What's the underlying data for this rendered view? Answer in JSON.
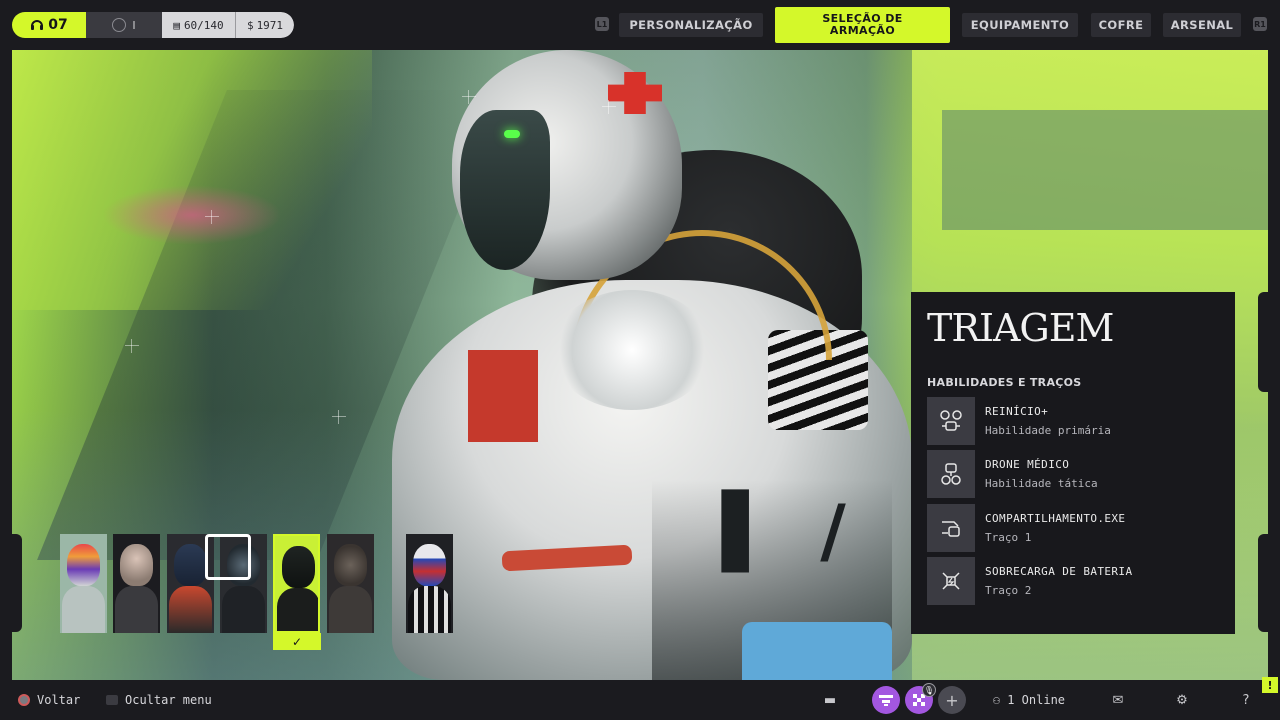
{
  "topbar": {
    "level": "07",
    "rank": "I",
    "inventory_count": "60/140",
    "credits": "1971",
    "bumper_left": "L1",
    "bumper_right": "R1",
    "tabs": [
      {
        "label": "PERSONALIZAÇÃO",
        "active": false
      },
      {
        "label_line1": "SELEÇÃO DE",
        "label_line2": "ARMAÇÃO",
        "active": true
      },
      {
        "label": "EQUIPAMENTO",
        "active": false
      },
      {
        "label": "COFRE",
        "active": false
      },
      {
        "label": "ARSENAL",
        "active": false
      }
    ]
  },
  "colors": {
    "accent": "#d4f82a",
    "panel_bg": "#18181c",
    "bar_bg": "#1b1b1f"
  },
  "panel": {
    "title": "TRIAGEM",
    "subtitle": "HABILIDADES E TRAÇOS",
    "abilities": [
      {
        "name": "REINÍCIO+",
        "type": "Habilidade primária",
        "icon": "revive-drones-icon"
      },
      {
        "name": "DRONE MÉDICO",
        "type": "Habilidade tática",
        "icon": "medic-drone-icon"
      },
      {
        "name": "COMPARTILHAMENTO.EXE",
        "type": "Traço 1",
        "icon": "share-icon"
      },
      {
        "name": "SOBRECARGA DE BATERIA",
        "type": "Traço 2",
        "icon": "battery-overload-icon"
      }
    ]
  },
  "armatures": {
    "selected_check": "✓"
  },
  "bottombar": {
    "back_label": "Voltar",
    "hide_menu_label": "Ocultar menu",
    "online_label": "1 Online",
    "add_symbol": "+",
    "help_symbol": "?",
    "alert_symbol": "!"
  }
}
